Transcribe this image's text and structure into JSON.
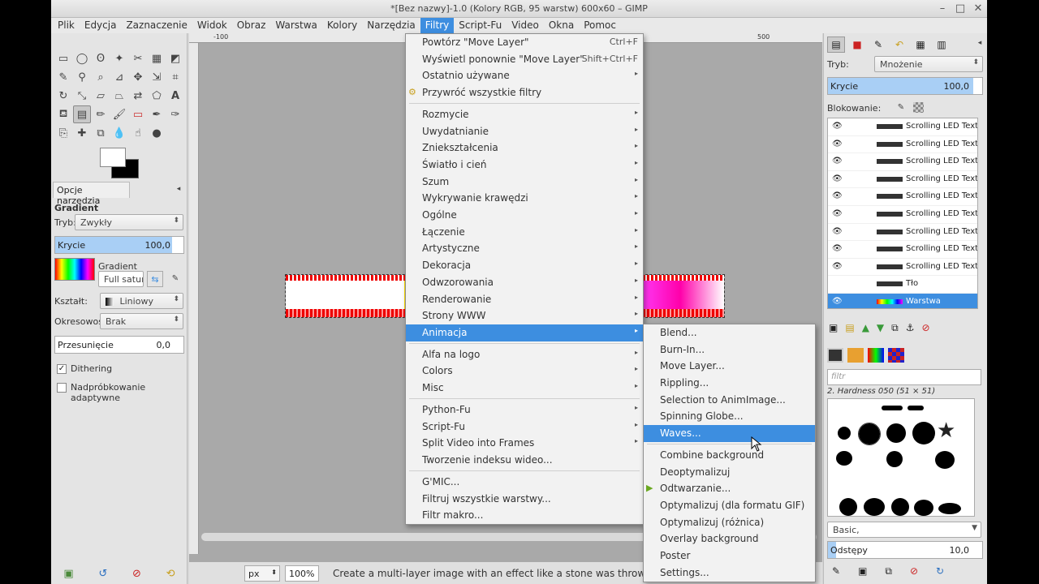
{
  "window": {
    "title": "*[Bez nazwy]-1.0 (Kolory RGB, 95 warstw) 600x60 – GIMP",
    "minimize": "–",
    "maximize": "□",
    "close": "✕"
  },
  "menubar": [
    "Plik",
    "Edycja",
    "Zaznaczenie",
    "Widok",
    "Obraz",
    "Warstwa",
    "Kolory",
    "Narzędzia",
    "Filtry",
    "Script-Fu",
    "Video",
    "Okna",
    "Pomoc"
  ],
  "tool_options": {
    "tab_label": "Opcje narzędzia",
    "heading": "Gradient",
    "mode_label": "Tryb:",
    "mode_value": "Zwykły",
    "opacity_label": "Krycie",
    "opacity_value": "100,0",
    "gradient_label": "Gradient",
    "gradient_name": "Full saturat",
    "shape_label": "Kształt:",
    "shape_value": "Liniowy",
    "repeat_label": "Okresowość:",
    "repeat_value": "Brak",
    "offset_label": "Przesunięcie",
    "offset_value": "0,0",
    "dithering_label": "Dithering",
    "dithering_checked": true,
    "adaptive_label": "Nadpróbkowanie adaptywne",
    "adaptive_checked": false
  },
  "ruler": {
    "left_mark": "-100",
    "right_mark": "500"
  },
  "statusbar": {
    "unit": "px",
    "zoom": "100%",
    "message": "Create a multi-layer image with an effect like a stone was thrown into the image"
  },
  "layers_panel": {
    "mode_label": "Tryb:",
    "mode_value": "Mnożenie",
    "opacity_label": "Krycie",
    "opacity_value": "100,0",
    "lock_label": "Blokowanie:",
    "layers": [
      {
        "name": "Scrolling LED Text"
      },
      {
        "name": "Scrolling LED Text"
      },
      {
        "name": "Scrolling LED Text"
      },
      {
        "name": "Scrolling LED Text"
      },
      {
        "name": "Scrolling LED Text"
      },
      {
        "name": "Scrolling LED Text"
      },
      {
        "name": "Scrolling LED Text"
      },
      {
        "name": "Scrolling LED Text"
      },
      {
        "name": "Scrolling LED Text"
      },
      {
        "name": "Tło"
      },
      {
        "name": "Warstwa",
        "selected": true
      }
    ]
  },
  "brushes_panel": {
    "filter_placeholder": "filtr",
    "brush_title": "2. Hardness 050 (51 × 51)",
    "preset_value": "Basic,",
    "spacing_label": "Odstępy",
    "spacing_value": "10,0"
  },
  "filters_menu": {
    "items": [
      {
        "label": "Powtórz \"Move Layer\"",
        "accel": "Ctrl+F"
      },
      {
        "label": "Wyświetl ponownie \"Move Layer\"",
        "accel": "Shift+Ctrl+F"
      },
      {
        "label": "Ostatnio używane",
        "sub": true
      },
      {
        "label": "Przywróć wszystkie filtry",
        "icon": true
      },
      {
        "sep": true
      },
      {
        "label": "Rozmycie",
        "sub": true
      },
      {
        "label": "Uwydatnianie",
        "sub": true
      },
      {
        "label": "Zniekształcenia",
        "sub": true
      },
      {
        "label": "Światło i cień",
        "sub": true
      },
      {
        "label": "Szum",
        "sub": true
      },
      {
        "label": "Wykrywanie krawędzi",
        "sub": true
      },
      {
        "label": "Ogólne",
        "sub": true
      },
      {
        "label": "Łączenie",
        "sub": true
      },
      {
        "label": "Artystyczne",
        "sub": true
      },
      {
        "label": "Dekoracja",
        "sub": true
      },
      {
        "label": "Odwzorowania",
        "sub": true
      },
      {
        "label": "Renderowanie",
        "sub": true
      },
      {
        "label": "Strony WWW",
        "sub": true
      },
      {
        "label": "Animacja",
        "sub": true,
        "highlighted": true
      },
      {
        "sep": true
      },
      {
        "label": "Alfa na logo",
        "sub": true
      },
      {
        "label": "Colors",
        "sub": true
      },
      {
        "label": "Misc",
        "sub": true
      },
      {
        "sep": true
      },
      {
        "label": "Python-Fu",
        "sub": true
      },
      {
        "label": "Script-Fu",
        "sub": true
      },
      {
        "label": "Split Video into Frames",
        "sub": true
      },
      {
        "label": "Tworzenie indeksu wideo..."
      },
      {
        "sep": true
      },
      {
        "label": "G'MIC..."
      },
      {
        "label": "Filtruj wszystkie warstwy..."
      },
      {
        "label": "Filtr makro..."
      }
    ]
  },
  "animation_menu": {
    "items": [
      {
        "label": "Blend..."
      },
      {
        "label": "Burn-In..."
      },
      {
        "label": "Move Layer..."
      },
      {
        "label": "Rippling..."
      },
      {
        "label": "Selection to AnimImage..."
      },
      {
        "label": "Spinning Globe..."
      },
      {
        "label": "Waves...",
        "highlighted": true
      },
      {
        "sep": true
      },
      {
        "label": "Combine background"
      },
      {
        "label": "Deoptymalizuj"
      },
      {
        "label": "Odtwarzanie...",
        "icon": true
      },
      {
        "label": "Optymalizuj (dla formatu GIF)"
      },
      {
        "label": "Optymalizuj (różnica)"
      },
      {
        "label": "Overlay background"
      },
      {
        "label": "Poster"
      },
      {
        "label": "Settings..."
      }
    ]
  },
  "colors": {
    "accent": "#3d8ee0",
    "slider_fill": "#a9cff5"
  }
}
